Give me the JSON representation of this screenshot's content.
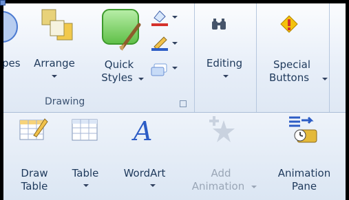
{
  "ribbon": {
    "top_row": {
      "shapes_partial": "pes",
      "arrange": "Arrange",
      "quick_styles_line1": "Quick",
      "quick_styles_line2": "Styles",
      "drawing_group": "Drawing",
      "editing": "Editing",
      "special_line1": "Special",
      "special_line2": "Buttons"
    },
    "bottom_row": {
      "draw_table_line1": "Draw",
      "draw_table_line2": "Table",
      "table": "Table",
      "wordart": "WordArt",
      "add_animation_line1": "Add",
      "add_animation_line2": "Animation",
      "animation_pane_line1": "Animation",
      "animation_pane_line2": "Pane"
    }
  },
  "icons": [
    "shapes-icon",
    "arrange-icon",
    "quick-styles-icon",
    "fill-color-icon",
    "outline-color-icon",
    "effects-icon",
    "find-binoculars-icon",
    "warning-diamond-icon",
    "draw-table-icon",
    "table-icon",
    "wordart-icon",
    "add-animation-star-icon",
    "animation-pane-icon"
  ],
  "colors": {
    "accent_red": "#d4312b",
    "accent_blue": "#2c5cc5",
    "accent_yellow": "#f4c20d"
  }
}
